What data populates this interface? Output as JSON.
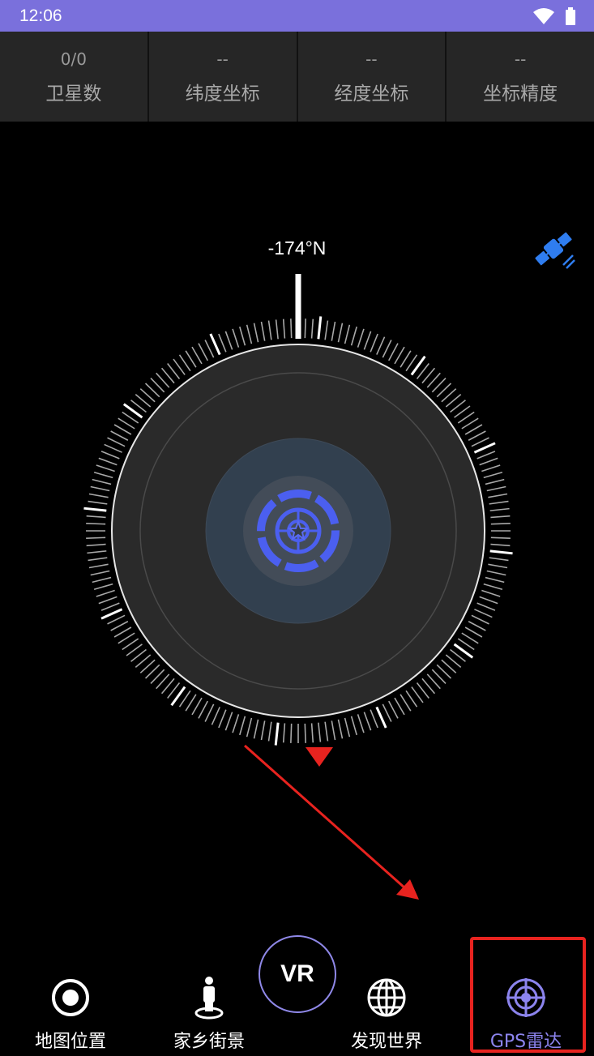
{
  "status_bar": {
    "time": "12:06"
  },
  "stats": [
    {
      "value": "0/0",
      "label": "卫星数"
    },
    {
      "value": "--",
      "label": "纬度坐标"
    },
    {
      "value": "--",
      "label": "经度坐标"
    },
    {
      "value": "--",
      "label": "坐标精度"
    }
  ],
  "compass": {
    "heading": "-174°N"
  },
  "icons": {
    "satellite": "satellite-icon",
    "wifi": "wifi-icon",
    "battery": "battery-icon"
  },
  "colors": {
    "status_bar": "#7a70dc",
    "accent": "#8c84ee",
    "radar_blue": "#4b5ff0",
    "highlight": "#e8231f",
    "satellite": "#2f7df0"
  },
  "bottom_nav": {
    "items": [
      {
        "label": "地图位置",
        "icon": "target-icon"
      },
      {
        "label": "家乡街景",
        "icon": "person-pin-icon"
      },
      {
        "label": "发现世界",
        "icon": "globe-icon"
      },
      {
        "label": "GPS雷达",
        "icon": "radar-icon",
        "active": true
      }
    ],
    "vr_label": "VR"
  }
}
